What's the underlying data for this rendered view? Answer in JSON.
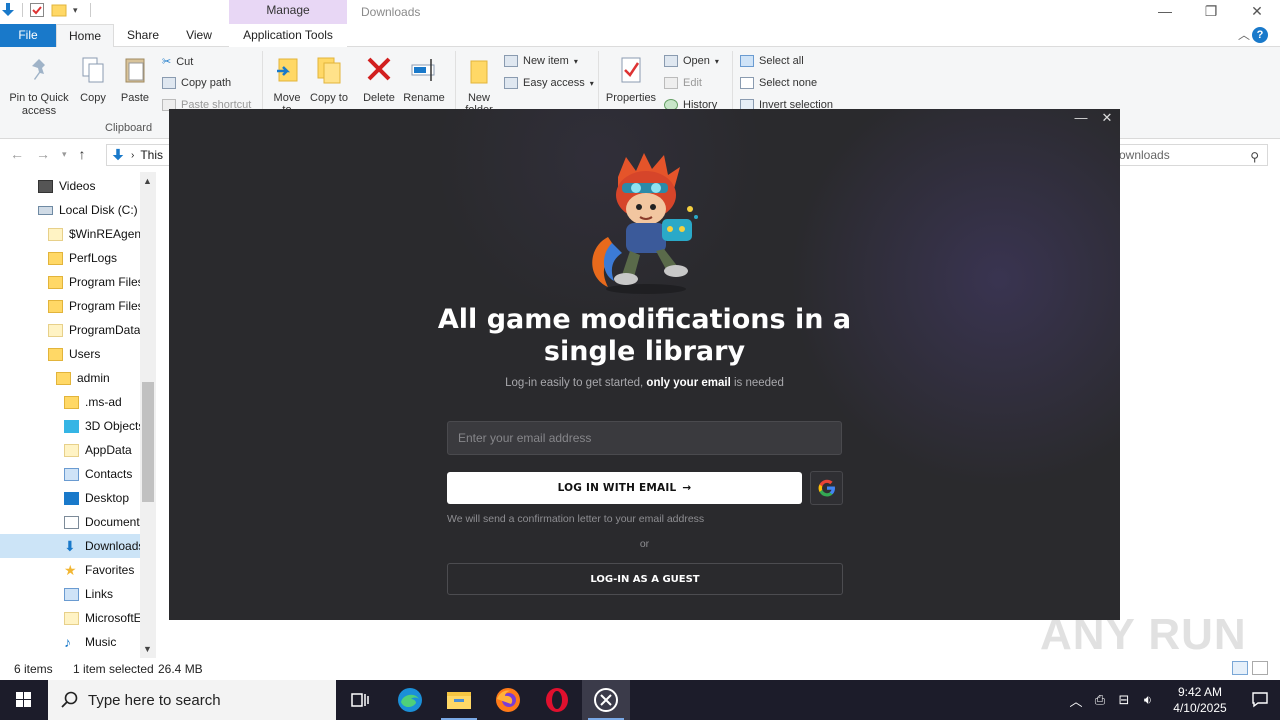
{
  "explorer": {
    "window_title": "Downloads",
    "manage_tab": "Manage",
    "tabs": {
      "file": "File",
      "home": "Home",
      "share": "Share",
      "view": "View",
      "app_tools": "Application Tools"
    },
    "ribbon": {
      "pin": "Pin to Quick access",
      "copy": "Copy",
      "paste": "Paste",
      "cut": "Cut",
      "copy_path": "Copy path",
      "paste_shortcut": "Paste shortcut",
      "clipboard_group": "Clipboard",
      "move_to": "Move to",
      "copy_to": "Copy to",
      "delete": "Delete",
      "rename": "Rename",
      "new_folder": "New folder",
      "new_item": "New item",
      "easy_access": "Easy access",
      "properties": "Properties",
      "open": "Open",
      "edit": "Edit",
      "history": "History",
      "select_all": "Select all",
      "select_none": "Select none",
      "invert_selection": "Invert selection"
    },
    "address": {
      "crumb": "This",
      "search_placeholder": "ownloads"
    },
    "nav_items": [
      {
        "label": "Videos"
      },
      {
        "label": "Local Disk (C:)"
      },
      {
        "label": "$WinREAgent"
      },
      {
        "label": "PerfLogs"
      },
      {
        "label": "Program Files"
      },
      {
        "label": "Program Files"
      },
      {
        "label": "ProgramData"
      },
      {
        "label": "Users"
      },
      {
        "label": "admin"
      },
      {
        "label": ".ms-ad"
      },
      {
        "label": "3D Objects"
      },
      {
        "label": "AppData"
      },
      {
        "label": "Contacts"
      },
      {
        "label": "Desktop"
      },
      {
        "label": "Documents"
      },
      {
        "label": "Downloads"
      },
      {
        "label": "Favorites"
      },
      {
        "label": "Links"
      },
      {
        "label": "MicrosoftEdge"
      },
      {
        "label": "Music"
      }
    ],
    "status": {
      "items": "6 items",
      "selected": "1 item selected",
      "size": "26.4 MB"
    },
    "watermark": "ANY RUN"
  },
  "modal": {
    "headline": "All game modifications in a single library",
    "sub_prefix": "Log-in easily to get started, ",
    "sub_bold": "only your email",
    "sub_suffix": " is needed",
    "email_placeholder": "Enter your email address",
    "login_email": "LOG IN WITH EMAIL",
    "arrow": "→",
    "confirm_note": "We will send a confirmation letter to your email address",
    "or": "or",
    "guest": "LOG-IN AS A GUEST"
  },
  "taskbar": {
    "search_placeholder": "Type here to search",
    "time": "9:42 AM",
    "date": "4/10/2025"
  },
  "colors": {
    "accent": "#1979ca",
    "modal_bg": "#2a2a2d",
    "taskbar": "#1c1c2a"
  }
}
